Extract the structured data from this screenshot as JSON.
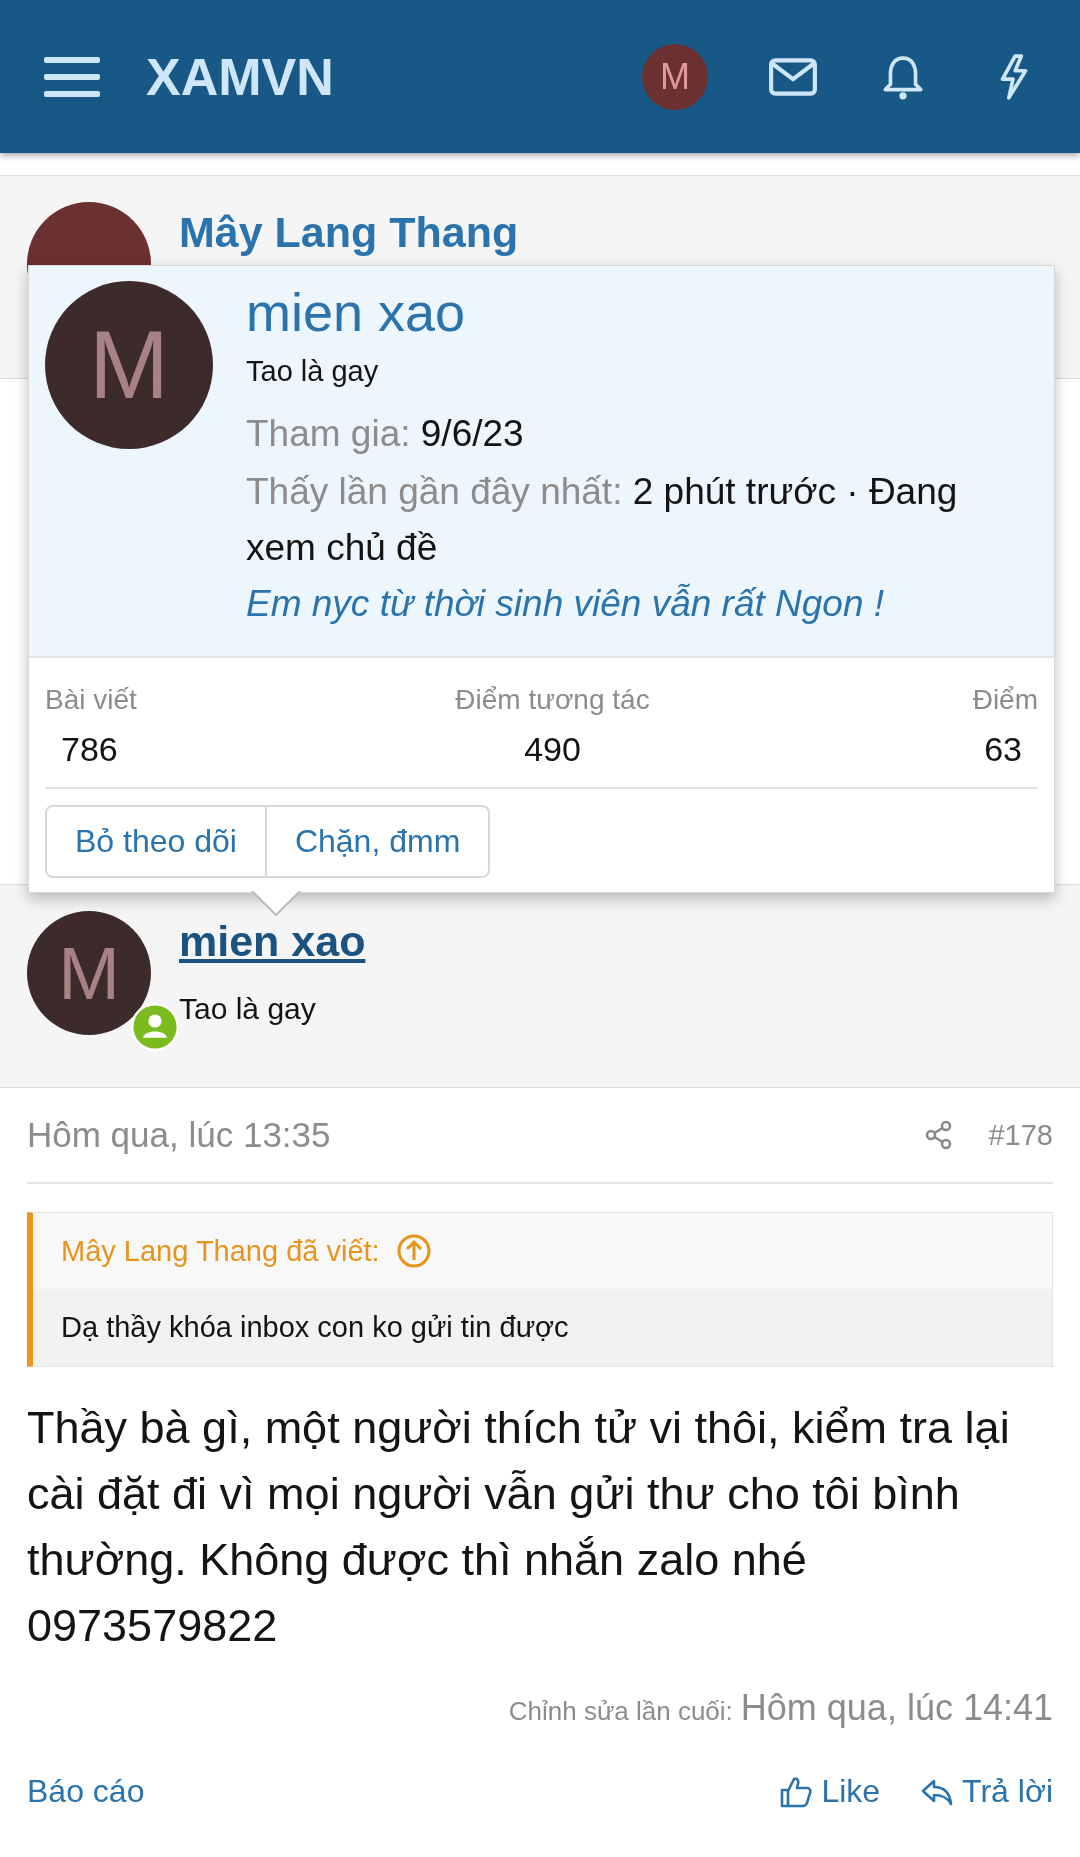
{
  "header": {
    "logo": "XAMVN",
    "avatar_letter": "M"
  },
  "previous_post": {
    "author": "Mây Lang Thang"
  },
  "member_popup": {
    "username": "mien xao",
    "avatar_letter": "M",
    "user_title": "Tao là gay",
    "joined_label": "Tham gia:",
    "joined": "9/6/23",
    "last_seen_label": "Thấy lần gần đây nhất:",
    "last_seen": "2 phút trước · Đang xem chủ đề",
    "thread_link": "Em nyc từ thời sinh viên vẫn rất Ngon !",
    "stats": [
      {
        "label": "Bài viết",
        "value": "786"
      },
      {
        "label": "Điểm tương tác",
        "value": "490"
      },
      {
        "label": "Điểm",
        "value": "63"
      }
    ],
    "buttons": [
      "Bỏ theo dõi",
      "Chặn, đmm"
    ]
  },
  "post": {
    "author": "mien xao",
    "avatar_letter": "M",
    "online": true,
    "user_title": "Tao là gay",
    "date": "Hôm qua, lúc 13:35",
    "number": "#178",
    "quote": {
      "author": "Mây Lang Thang đã viết:",
      "text": "Dạ thầy khóa inbox con ko gửi tin được"
    },
    "body": "Thầy bà gì, một người thích tử vi thôi, kiểm tra lại cài đặt đi vì mọi người vẫn gửi thư cho tôi bình thường. Không được thì nhắn zalo nhé 0973579822",
    "edited_label": "Chỉnh sửa lần cuối:",
    "edited_time": "Hôm qua, lúc 14:41",
    "actions": {
      "report": "Báo cáo",
      "like": "Like",
      "reply": "Trả lời"
    }
  }
}
